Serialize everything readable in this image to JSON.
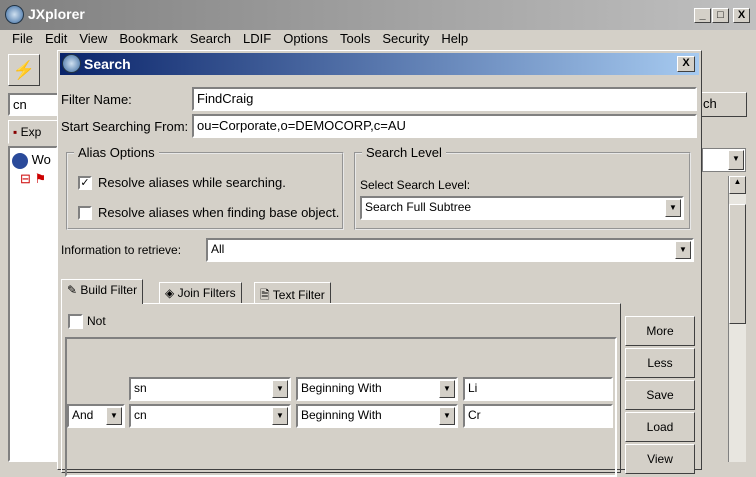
{
  "app": {
    "title": "JXplorer",
    "window_controls": [
      "_",
      "□",
      "X"
    ]
  },
  "menu": [
    "File",
    "Edit",
    "View",
    "Bookmark",
    "Search",
    "LDIF",
    "Options",
    "Tools",
    "Security",
    "Help"
  ],
  "background": {
    "quick_search_value": "cn",
    "search_button_partial": "ch",
    "explorer_tab_partial": "Exp",
    "tree_root_partial": "Wo"
  },
  "dialog": {
    "title": "Search",
    "close": "X",
    "filter_name_label": "Filter Name:",
    "filter_name_value": "FindCraig",
    "start_label": "Start Searching From:",
    "start_value": "ou=Corporate,o=DEMOCORP,c=AU",
    "alias": {
      "title": "Alias Options",
      "opt1": "Resolve aliases while searching.",
      "opt1_checked": true,
      "opt2": "Resolve aliases when finding base object.",
      "opt2_checked": false,
      "check": "✓"
    },
    "level": {
      "title": "Search Level",
      "label": "Select Search Level:",
      "value": "Search Full Subtree"
    },
    "info_label": "Information to retrieve:",
    "info_value": "All",
    "tabs": [
      {
        "label": "Build Filter",
        "icon": "pencil-icon"
      },
      {
        "label": "Join Filters",
        "icon": "stack-icon"
      },
      {
        "label": "Text Filter",
        "icon": "document-icon"
      }
    ],
    "not_label": "Not",
    "rows": [
      {
        "op": "",
        "attr": "sn",
        "cond": "Beginning With",
        "value": "Li"
      },
      {
        "op": "And",
        "attr": "cn",
        "cond": "Beginning With",
        "value": "Cr"
      }
    ],
    "buttons": [
      "More",
      "Less",
      "Save",
      "Load",
      "View"
    ]
  }
}
